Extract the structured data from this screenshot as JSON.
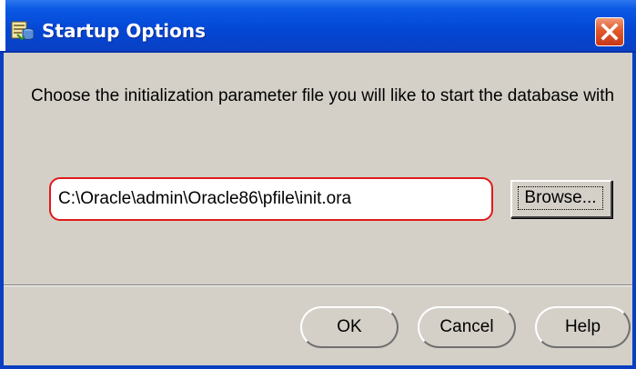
{
  "window": {
    "title": "Startup Options",
    "close_label": "Close"
  },
  "message": "Choose the initialization parameter file you will like to start the database with",
  "file_path": {
    "value": "C:\\Oracle\\admin\\Oracle86\\pfile\\init.ora"
  },
  "buttons": {
    "browse": "Browse...",
    "ok": "OK",
    "cancel": "Cancel",
    "help": "Help"
  },
  "colors": {
    "title_bar": "#0346d4",
    "dialog_background": "#d4d0c8",
    "highlight_border": "#e01a1a",
    "close_button": "#e05a2a"
  },
  "icons": {
    "app": "database-icon",
    "close": "close-icon"
  }
}
